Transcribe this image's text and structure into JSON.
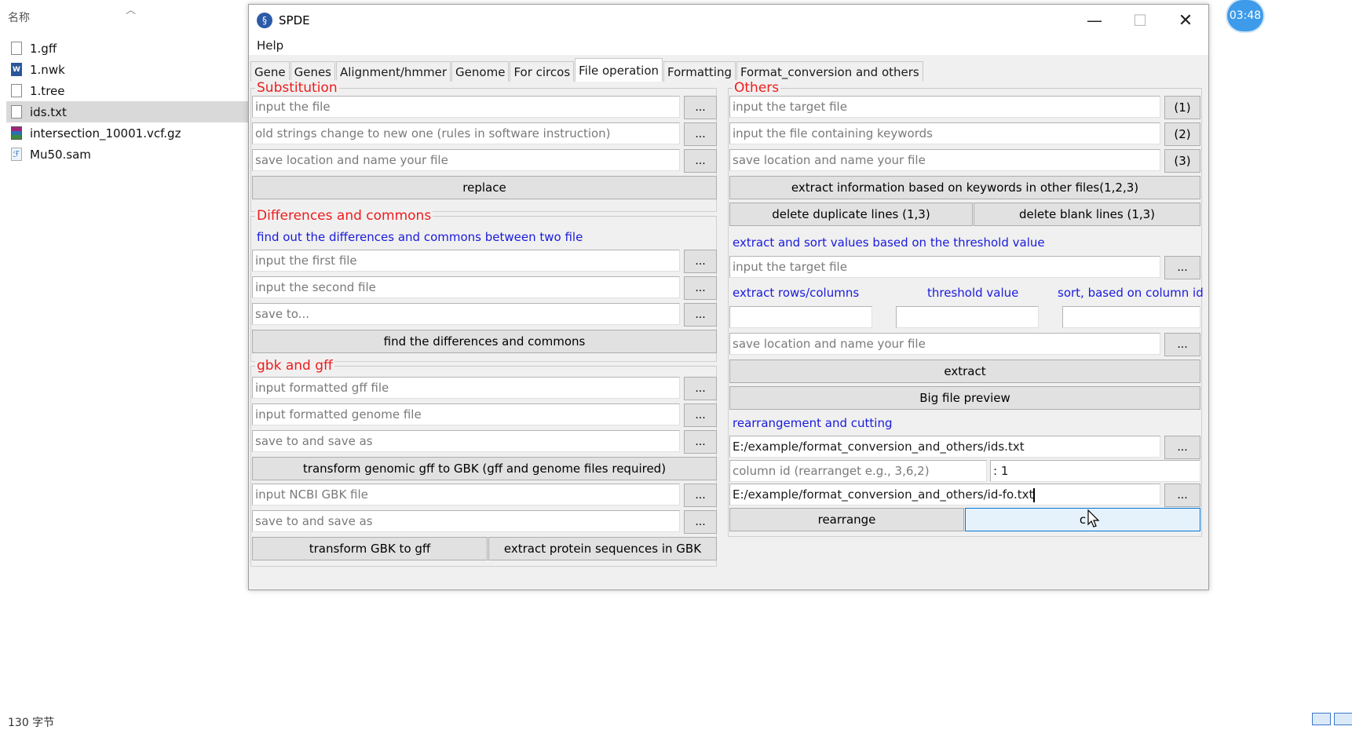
{
  "explorer": {
    "column_header": "名称",
    "files": [
      {
        "name": "1.gff",
        "icon": "doc-icon"
      },
      {
        "name": "1.nwk",
        "icon": "word-icon"
      },
      {
        "name": "1.tree",
        "icon": "doc-icon"
      },
      {
        "name": "ids.txt",
        "icon": "doc-icon"
      },
      {
        "name": "intersection_10001.vcf.gz",
        "icon": "rar-icon"
      },
      {
        "name": "Mu50.sam",
        "icon": "sam-icon"
      }
    ],
    "status": "130 字节",
    "timer": "03:48"
  },
  "window": {
    "title": "SPDE",
    "menu": [
      "Help"
    ],
    "tabs": [
      "Gene",
      "Genes",
      "Alignment/hmmer",
      "Genome",
      "For circos",
      "File operation",
      "Formatting",
      "Format_conversion and others"
    ],
    "active_tab": "File operation"
  },
  "substitution": {
    "title": "Substitution",
    "input_file": "input the file",
    "old_new": "old strings change to new one (rules in software instruction)",
    "save": "save location and name your file",
    "browse": "...",
    "replace_btn": "replace"
  },
  "differences": {
    "title": "Differences and commons",
    "description": "find out the differences and commons between two file",
    "first": "input the first file",
    "second": "input the second file",
    "save": "save to...",
    "browse": "...",
    "find_btn": "find the differences and commons"
  },
  "gbk": {
    "title": "gbk and gff",
    "gff": "input formatted gff file",
    "genome": "input formatted genome file",
    "save1": "save to and save as",
    "transform_btn": "transform genomic gff to GBK (gff and genome files required)",
    "ncbi": "input NCBI GBK file",
    "save2": "save to and save as",
    "browse": "...",
    "to_gff_btn": "transform GBK to gff",
    "extract_protein_btn": "extract protein sequences in GBK"
  },
  "others": {
    "title": "Others",
    "target": "input the target file",
    "keywords": "input the file containing keywords",
    "save": "save location and name your file",
    "btn1": "(1)",
    "btn2": "(2)",
    "btn3": "(3)",
    "extract_info_btn": "extract information based on keywords in other files(1,2,3)",
    "dup_btn": "delete duplicate lines (1,3)",
    "blank_btn": "delete blank lines (1,3)",
    "threshold_title": "extract and sort values based on the threshold value",
    "threshold_target": "input the target file",
    "rows_label": "extract rows/columns",
    "threshold_label": "threshold value",
    "sort_label": "sort, based on column id",
    "threshold_save": "save location and name your file",
    "extract_btn": "extract",
    "preview_btn": "Big file preview",
    "rearrange_title": "rearrangement and cutting",
    "rearrange_input": "E:/example/format_conversion_and_others/ids.txt",
    "column_id": "column id (rearranget e.g., 3,6,2)",
    "column_value": ": 1",
    "rearrange_output": "E:/example/format_conversion_and_others/id-fo.txt",
    "rearrange_btn": "rearrange",
    "cut_btn": "c",
    "browse": "..."
  }
}
